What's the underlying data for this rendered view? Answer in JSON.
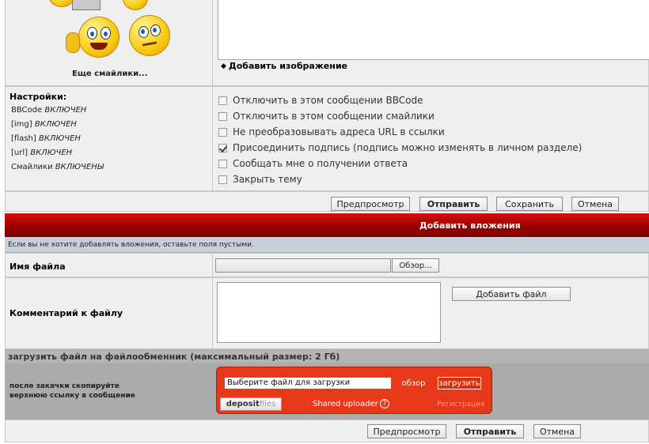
{
  "smilies": {
    "more_link": "Еще смайлики..."
  },
  "message": {
    "add_image_label": "Добавить изображение"
  },
  "settings": {
    "title": "Настройки:",
    "lines": [
      {
        "name": "BBCode",
        "state": "ВКЛЮЧЕН"
      },
      {
        "name": "[img]",
        "state": "ВКЛЮЧЕН"
      },
      {
        "name": "[flash]",
        "state": "ВКЛЮЧЕН"
      },
      {
        "name": "[url]",
        "state": "ВКЛЮЧЕН"
      },
      {
        "name": "Смайлики",
        "state": "ВКЛЮЧЕНЫ"
      }
    ],
    "options": [
      {
        "label": "Отключить в этом сообщении BBCode",
        "checked": false
      },
      {
        "label": "Отключить в этом сообщении смайлики",
        "checked": false
      },
      {
        "label": "Не преобразовывать адреса URL в ссылки",
        "checked": false
      },
      {
        "label": "Присоединить подпись (подпись можно изменять в личном разделе)",
        "checked": true
      },
      {
        "label": "Сообщать мне о получении ответа",
        "checked": false
      },
      {
        "label": "Закрыть тему",
        "checked": false
      }
    ]
  },
  "actions1": {
    "preview": "Предпросмотр",
    "submit": "Отправить",
    "save": "Сохранить",
    "cancel": "Отмена"
  },
  "attachments": {
    "header": "Добавить вложения",
    "hint": "Если вы не хотите добавлять вложения, оставьте поля пустыми.",
    "filename_label": "Имя файла",
    "browse": "Обзор...",
    "comment_label": "Комментарий к файлу",
    "add_file": "Добавить файл"
  },
  "fileshare": {
    "header": "загрузить файл на файлообменник (максимальный размер: 2 Гб)",
    "instruction_line1": "после закачки скопируйте",
    "instruction_line2": "верхнюю ссылку в сообщение",
    "widget": {
      "file_placeholder": "Выберите файл для загрузки",
      "browse": "обзор",
      "upload": "загрузить",
      "logo_left": "deposit",
      "logo_right": "files",
      "caption": "Shared uploader",
      "help_glyph": "?",
      "register": "Регистрация"
    }
  },
  "actions2": {
    "preview": "Предпросмотр",
    "submit": "Отправить",
    "cancel": "Отмена"
  },
  "colors": {
    "header_red": "#b30000",
    "widget_red": "#e53a12",
    "cell_bg": "#efefef",
    "gray_band": "#b9b9b9"
  }
}
